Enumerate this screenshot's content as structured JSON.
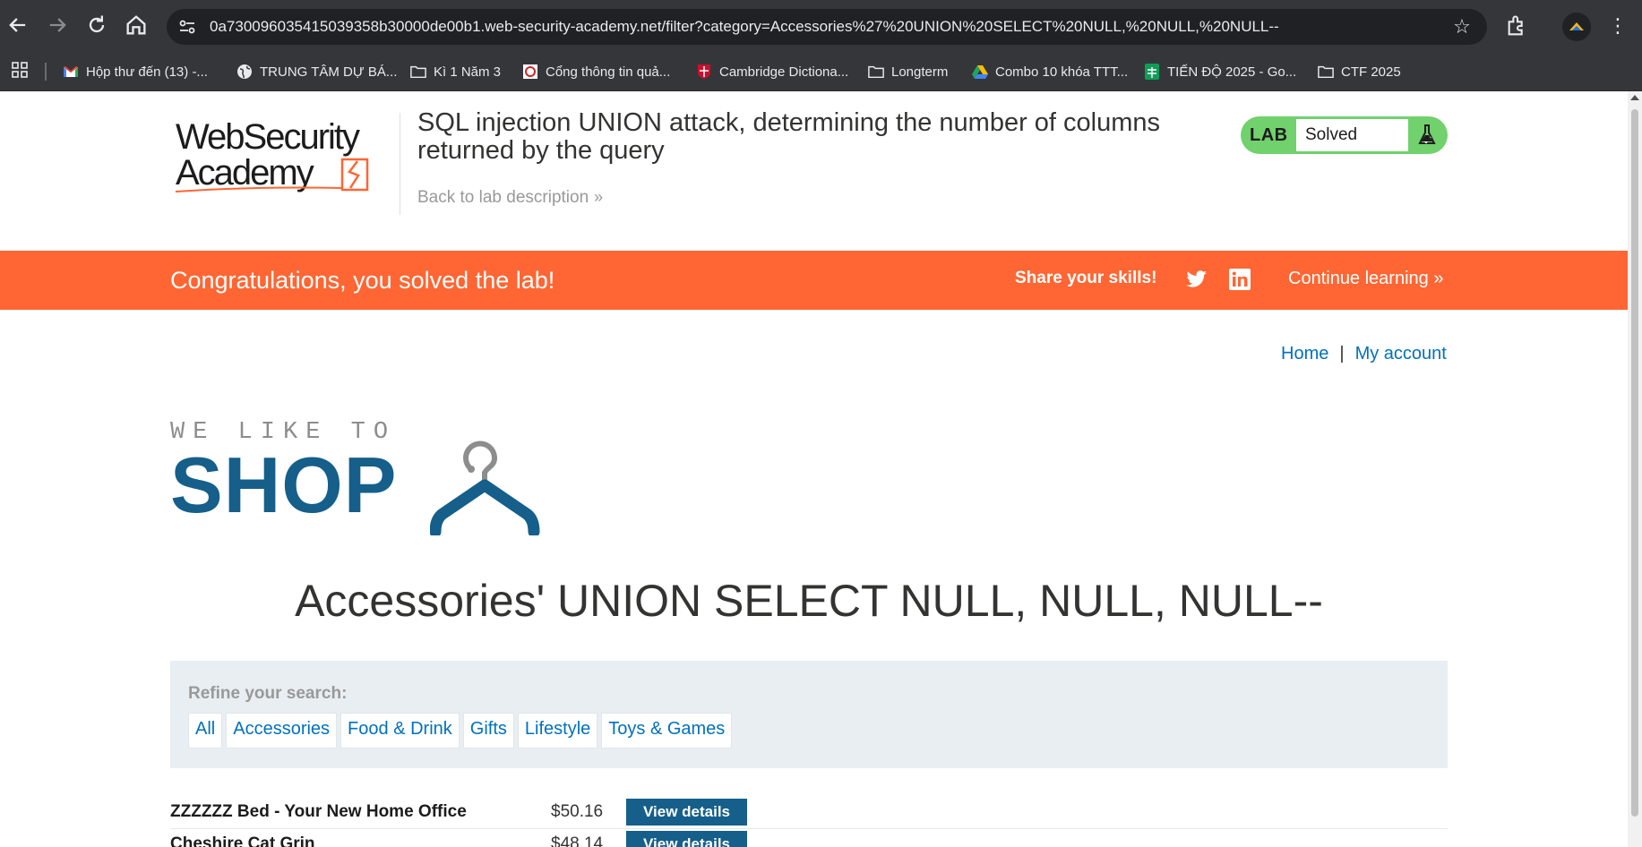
{
  "browser": {
    "url": "0a730096035415039358b30000de00b1.web-security-academy.net/filter?category=Accessories%27%20UNION%20SELECT%20NULL,%20NULL,%20NULL--",
    "bookmarks": [
      {
        "label": "Hộp thư đến (13) -...",
        "icon": "gmail-icon"
      },
      {
        "label": "TRUNG TÂM DỰ BÁ...",
        "icon": "globe-icon"
      },
      {
        "label": "Kì 1 Năm 3",
        "icon": "folder-icon"
      },
      {
        "label": "Cổng thông tin quả...",
        "icon": "portal-icon"
      },
      {
        "label": "Cambridge Dictiona...",
        "icon": "cambridge-icon"
      },
      {
        "label": "Longterm",
        "icon": "folder-icon"
      },
      {
        "label": "Combo 10 khóa TTT...",
        "icon": "drive-icon"
      },
      {
        "label": "TIẾN ĐỘ 2025 - Go...",
        "icon": "sheets-icon"
      },
      {
        "label": "CTF 2025",
        "icon": "folder-icon"
      }
    ]
  },
  "header": {
    "logo_line1": "WebSecurity",
    "logo_line2": "Academy",
    "lab_title": "SQL injection UNION attack, determining the number of columns returned by the query",
    "back_link": "Back to lab description",
    "lab_badge": "LAB",
    "lab_status": "Solved"
  },
  "banner": {
    "message": "Congratulations, you solved the lab!",
    "share": "Share your skills!",
    "continue": "Continue learning"
  },
  "nav": {
    "home": "Home",
    "separator": "|",
    "account": "My account"
  },
  "shop": {
    "tagline": "WE LIKE TO",
    "name": "SHOP"
  },
  "category_title": "Accessories' UNION SELECT NULL, NULL, NULL--",
  "refine": {
    "label": "Refine your search:",
    "filters": [
      "All",
      "Accessories",
      "Food & Drink",
      "Gifts",
      "Lifestyle",
      "Toys & Games"
    ]
  },
  "products": [
    {
      "name": "ZZZZZZ Bed - Your New Home Office",
      "price": "$50.16",
      "button": "View details"
    },
    {
      "name": "Cheshire Cat Grin",
      "price": "$48.14",
      "button": "View details"
    }
  ],
  "colors": {
    "accent_orange": "#ff6633",
    "brand_blue": "#155f8a",
    "link_blue": "#0071bc",
    "solved_green": "#70d16d"
  }
}
